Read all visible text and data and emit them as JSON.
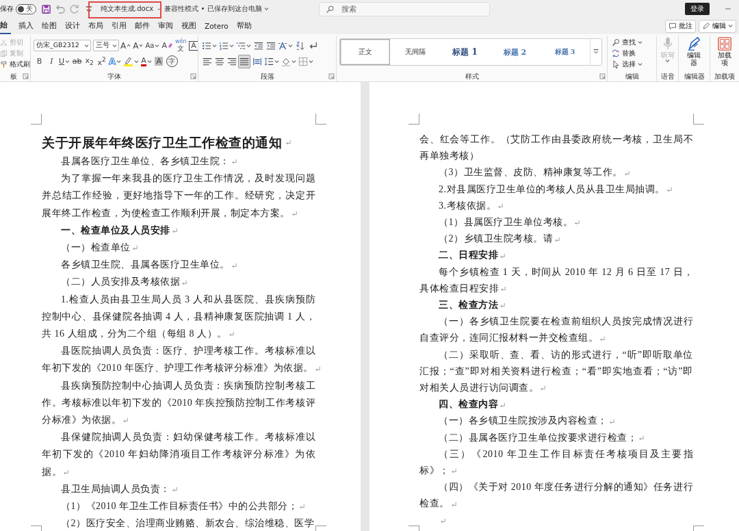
{
  "window": {
    "autosave_label": "保存",
    "autosave_toggle": {
      "label": "关",
      "on": false
    },
    "title": "纯文本生成.docx  -  兼容性模式 • 已保存到这台电脑",
    "search": {
      "placeholder": "搜索"
    },
    "sign_in": "登录"
  },
  "tabs": [
    {
      "label": "始",
      "selected": true
    },
    {
      "label": "插入",
      "selected": false
    },
    {
      "label": "绘图",
      "selected": false
    },
    {
      "label": "设计",
      "selected": false
    },
    {
      "label": "布局",
      "selected": false
    },
    {
      "label": "引用",
      "selected": false
    },
    {
      "label": "邮件",
      "selected": false
    },
    {
      "label": "审阅",
      "selected": false
    },
    {
      "label": "视图",
      "selected": false
    },
    {
      "label": "Zotero",
      "selected": false
    },
    {
      "label": "帮助",
      "selected": false
    }
  ],
  "tab_actions": [
    {
      "kind": "comments",
      "label": "批注"
    },
    {
      "kind": "editing",
      "label": "编辑"
    }
  ],
  "ribbon": {
    "clipboard": {
      "items": [
        {
          "kind": "cut",
          "label": "剪切",
          "disabled": true
        },
        {
          "kind": "copy",
          "label": "复制",
          "disabled": true
        },
        {
          "kind": "painter",
          "label": "格式刷",
          "disabled": false
        }
      ],
      "group_label": "板"
    },
    "font": {
      "font_name": "仿宋_GB2312",
      "font_size": "三号",
      "group_label": "字体",
      "row1": [
        {
          "kind": "grow",
          "text": "A"
        },
        {
          "kind": "shrink",
          "text": "A"
        },
        {
          "kind": "case",
          "text": "Aa"
        },
        {
          "kind": "clear",
          "text": "A"
        },
        {
          "kind": "pinyin",
          "text": "文",
          "ruby": "wén"
        },
        {
          "kind": "border",
          "text": "A"
        }
      ],
      "row2": [
        {
          "kind": "bold",
          "text": "B"
        },
        {
          "kind": "italic",
          "text": "I"
        },
        {
          "kind": "underline",
          "text": "U"
        },
        {
          "kind": "strike",
          "text": "ab"
        },
        {
          "kind": "sub",
          "text": "x$_{2}$"
        },
        {
          "kind": "sup",
          "text": "x$^{2}$"
        },
        {
          "kind": "effects",
          "text": "A"
        },
        {
          "kind": "highlight"
        },
        {
          "kind": "color",
          "text": "A"
        },
        {
          "kind": "shade",
          "text": "A"
        },
        {
          "kind": "enclose",
          "text": "字"
        }
      ]
    },
    "paragraph": {
      "group_label": "段落",
      "alignments": [
        {
          "kind": "left",
          "selected": false
        },
        {
          "kind": "center",
          "selected": false
        },
        {
          "kind": "right",
          "selected": false
        },
        {
          "kind": "justify",
          "selected": true
        },
        {
          "kind": "distributed",
          "selected": false
        }
      ]
    },
    "styles": {
      "group_label": "样式",
      "items": [
        {
          "kind": "normal",
          "label": "正文",
          "selected": true
        },
        {
          "kind": "normal",
          "label": "无间隔",
          "selected": false
        },
        {
          "kind": "heading1",
          "label": "标题 1",
          "selected": false
        },
        {
          "kind": "heading2",
          "label": "标题 2",
          "selected": false
        },
        {
          "kind": "heading3",
          "label": "标题 3",
          "selected": false
        }
      ]
    },
    "editing": {
      "group_label": "编辑",
      "items": [
        {
          "kind": "find",
          "label": "查找"
        },
        {
          "kind": "replace",
          "label": "替换"
        },
        {
          "kind": "select",
          "label": "选择"
        }
      ]
    },
    "voice": {
      "group_label": "语音",
      "label": "听写",
      "disabled": true
    },
    "editor": {
      "group_label": "编辑器",
      "label": "编辑器"
    },
    "addins": {
      "group_label": "加载项",
      "label": "加载项"
    }
  },
  "pages": [
    {
      "paragraphs": [
        {
          "kind": "title",
          "text": "关于开展年年终医疗卫生工作检查的通知",
          "mark": true
        },
        {
          "kind": "para",
          "text": "县属各医疗卫生单位、各乡镇卫生院：",
          "mark": true
        },
        {
          "kind": "para",
          "text": "为了掌握一年来我县的医疗卫生工作情况，及时发现问题并总结工作经验，更好地指导下一年的工作。经研究，决定开展年终工作检查，为使检查工作顺利开展，制定本方案。",
          "mark": true
        },
        {
          "kind": "heading",
          "text": "一、检查单位及人员安排",
          "mark": true
        },
        {
          "kind": "para",
          "text": "（一）检查单位",
          "mark": true
        },
        {
          "kind": "para",
          "text": "各乡镇卫生院、县属各医疗卫生单位。",
          "mark": true
        },
        {
          "kind": "para",
          "text": "（二）人员安排及考核依据",
          "mark": true
        },
        {
          "kind": "para",
          "text": "1.检查人员由县卫生局人员 3 人和从县医院、县疾病预防控制中心、县保健院各抽调 4 人，县精神康复医院抽调 1 人，共 16 人组成，分为二个组（每组 8 人）。",
          "mark": true
        },
        {
          "kind": "para",
          "text": "县医院抽调人员负责：医疗、护理考核工作。考核标准以年初下发的《2010 年医疗、护理工作考核评分标准》为依据。",
          "mark": true
        },
        {
          "kind": "para",
          "text": "县疾病预防控制中心抽调人员负责：疾病预防控制考核工作。考核标准以年初下发的《2010 年疾控预防控制工作考核评分标准》为依据。",
          "mark": true
        },
        {
          "kind": "para",
          "text": "县保健院抽调人员负责：妇幼保健考核工作。考核标准以年初下发的《2010 年妇幼降消项目工作考核评分标准》为依据。",
          "mark": true
        },
        {
          "kind": "para",
          "text": "县卫生局抽调人员负责：",
          "mark": true
        },
        {
          "kind": "para",
          "text": "（1）《2010 年卫生工作目标责任书》中的公共部分；",
          "mark": true
        },
        {
          "kind": "para",
          "text": "（2）医疗安全、治理商业贿赂、新农合、综治维稳、医学",
          "mark": false
        }
      ]
    },
    {
      "paragraphs": [
        {
          "kind": "cont",
          "text": "会、红会等工作。（艾防工作由县委政府统一考核，卫生局不再单独考核）",
          "mark": false
        },
        {
          "kind": "para",
          "text": "（3）卫生监督、皮防、精神康复等工作。",
          "mark": true
        },
        {
          "kind": "para",
          "text": "2.对县属医疗卫生单位的考核人员从县卫生局抽调。",
          "mark": true
        },
        {
          "kind": "para",
          "text": "3.考核依据。",
          "mark": true
        },
        {
          "kind": "para",
          "text": "（1）县属医疗卫生单位考核。",
          "mark": true
        },
        {
          "kind": "para",
          "text": "（2）乡镇卫生院考核。请",
          "mark": true
        },
        {
          "kind": "heading",
          "text": "二、日程安排",
          "mark": true
        },
        {
          "kind": "para",
          "text": "每个乡镇检查 1 天，时间从 2010 年 12 月 6 日至 17 日，具体检查日程安排",
          "mark": true
        },
        {
          "kind": "heading",
          "text": "三、检查方法",
          "mark": true
        },
        {
          "kind": "para",
          "text": "（一）各乡镇卫生院要在检查前组织人员按完成情况进行自查评分，连同汇报材料一并交检查组。",
          "mark": true
        },
        {
          "kind": "para",
          "text": "（二）采取听、查、看、访的形式进行，“听”即听取单位汇报；“查”即对相关资料进行检查；“看”即实地查看；“访”即对相关人员进行访问调查。",
          "mark": true
        },
        {
          "kind": "heading",
          "text": "四、检查内容",
          "mark": true
        },
        {
          "kind": "para",
          "text": "（一）各乡镇卫生院按涉及内容检查；",
          "mark": true
        },
        {
          "kind": "para",
          "text": "（二）县属各医疗卫生单位按要求进行检查；",
          "mark": true
        },
        {
          "kind": "para",
          "text": "（三）《2010 年卫生工作目标责任考核项目及主要指标》；",
          "mark": true
        },
        {
          "kind": "para",
          "text": "（四）《关于对 2010 年度任务进行分解的通知》任务进行检查。",
          "mark": true
        },
        {
          "kind": "empty",
          "mark": true
        }
      ]
    }
  ]
}
